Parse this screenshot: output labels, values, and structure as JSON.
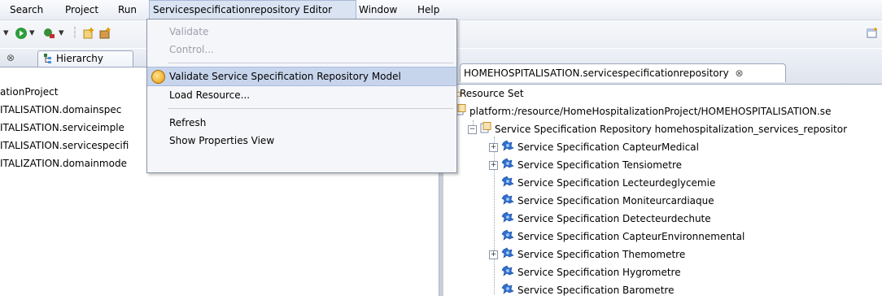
{
  "menubar": {
    "items": [
      "Search",
      "Project",
      "Run",
      "Servicespecificationrepository Editor",
      "Window",
      "Help"
    ]
  },
  "dropdown": {
    "items": [
      {
        "label": "Validate",
        "disabled": true
      },
      {
        "label": "Control...",
        "disabled": true
      },
      {
        "label": "Validate Service Specification Repository Model",
        "highlighted": true
      },
      {
        "label": "Load Resource..."
      },
      {
        "label": "Refresh"
      },
      {
        "label": "Show Properties View"
      }
    ]
  },
  "left_view": {
    "tab_label": "Hierarchy",
    "tab_close": "⊗",
    "items": [
      "ationProject",
      "ITALISATION.domainspec",
      "ITALISATION.serviceimple",
      "ITALISATION.servicespecifi",
      "ITALIZATION.domainmode"
    ]
  },
  "editor": {
    "tab_label": "HOMEHOSPITALISATION.servicespecificationrepository",
    "tab_close": "⊗",
    "resource_tab": "Resource Set",
    "platform_path": "platform:/resource/HomeHospitalizationProject/HOMEHOSPITALISATION.se",
    "repository_label": "Service Specification Repository homehospitalization_services_repositor",
    "specs": [
      {
        "label": "Service Specification CapteurMedical",
        "expandable": true
      },
      {
        "label": "Service Specification Tensiometre",
        "expandable": true
      },
      {
        "label": "Service Specification Lecteurdeglycemie",
        "expandable": false
      },
      {
        "label": "Service Specification Moniteurcardiaque",
        "expandable": false
      },
      {
        "label": "Service Specification Detecteurdechute",
        "expandable": false
      },
      {
        "label": "Service Specification CapteurEnvironnemental",
        "expandable": false
      },
      {
        "label": "Service Specification Themometre",
        "expandable": true
      },
      {
        "label": "Service Specification Hygrometre",
        "expandable": false
      },
      {
        "label": "Service Specification Barometre",
        "expandable": false
      }
    ]
  },
  "colors": {
    "menu_highlight": "#c7d5ec",
    "accent_orange": "#e69a10",
    "spec_icon_blue": "#2f6fd0"
  }
}
